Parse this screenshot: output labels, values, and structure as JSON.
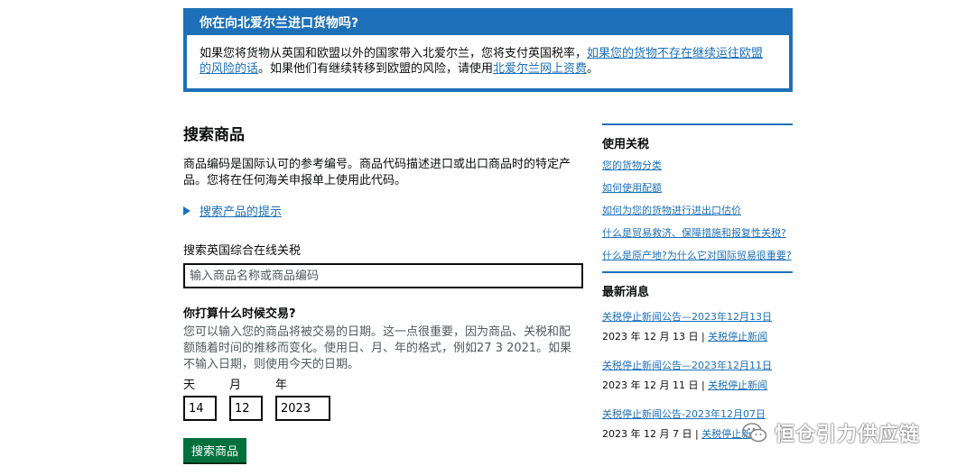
{
  "banner": {
    "title": "你在向北爱尔兰进口货物吗?",
    "text_1": "如果您将货物从英国和欧盟以外的国家带入北爱尔兰，您将支付英国税率，",
    "link_1": "如果您的货物不存在继续运往欧盟的风险的话",
    "text_2": "。如果他们有继续转移到欧盟的风险，请使用",
    "link_2": "北爱尔兰网上资费",
    "text_3": "。"
  },
  "main": {
    "heading": "搜索商品",
    "intro": "商品编码是国际认可的参考编号。商品代码描述进口或出口商品时的特定产品。您将在任何海关申报单上使用此代码。",
    "details_link": "搜索产品的提示",
    "search_label": "搜索英国综合在线关税",
    "search_placeholder": "输入商品名称或商品编码",
    "date_heading": "你打算什么时候交易?",
    "date_hint": "您可以输入您的商品将被交易的日期。这一点很重要，因为商品、关税和配额随着时间的推移而变化。使用日、月、年的格式，例如27 3 2021。如果不输入日期，则使用今天的日期。",
    "day_label": "天",
    "month_label": "月",
    "year_label": "年",
    "day_value": "14",
    "month_value": "12",
    "year_value": "2023",
    "submit_label": "搜索商品"
  },
  "sidebar": {
    "tariff_heading": "使用关税",
    "links": [
      "您的货物分类",
      "如何使用配额",
      "如何为您的货物进行进出口估价",
      "什么是贸易救济、保障措施和报复性关税?",
      "什么是原产地?为什么它对国际贸易很重要?"
    ],
    "news_heading": "最新消息",
    "news": [
      {
        "title": "关税停止新闻公告—2023年12月13日",
        "date": "2023 年 12 月 13 日 | ",
        "tag": "关税停止新闻"
      },
      {
        "title": "关税停止新闻公告—2023年12月11日",
        "date": "2023 年 12 月 11 日 | ",
        "tag": "关税停止新闻"
      },
      {
        "title": "关税停止新闻公告-2023年12月07日",
        "date": "2023 年 12 月 7 日 | ",
        "tag": "关税停止新闻"
      }
    ]
  },
  "watermark": {
    "text": "恒仓引力供应链",
    "icon": "wechat-icon"
  },
  "colors": {
    "link": "#1d70b8",
    "button": "#00703c",
    "text": "#0b0c0c",
    "hint": "#505a5f"
  }
}
